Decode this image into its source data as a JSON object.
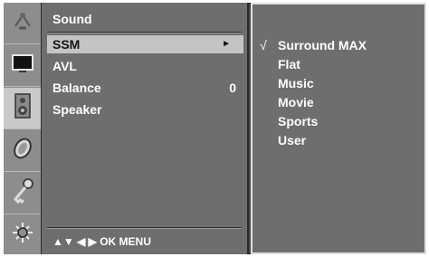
{
  "icons": [
    "antenna-icon",
    "screen-icon",
    "speaker-icon",
    "clock-icon",
    "key-icon",
    "settings-icon"
  ],
  "menu": {
    "title": "Sound",
    "items": [
      {
        "label": "SSM",
        "arrow": "►",
        "value": ""
      },
      {
        "label": "AVL",
        "arrow": "",
        "value": ""
      },
      {
        "label": "Balance",
        "arrow": "",
        "value": "0"
      },
      {
        "label": "Speaker",
        "arrow": "",
        "value": ""
      }
    ],
    "nav": "▲▼  ◀ ▶  OK  MENU"
  },
  "submenu": {
    "check": "√",
    "items": [
      "Surround MAX",
      "Flat",
      "Music",
      "Movie",
      "Sports",
      "User"
    ]
  }
}
